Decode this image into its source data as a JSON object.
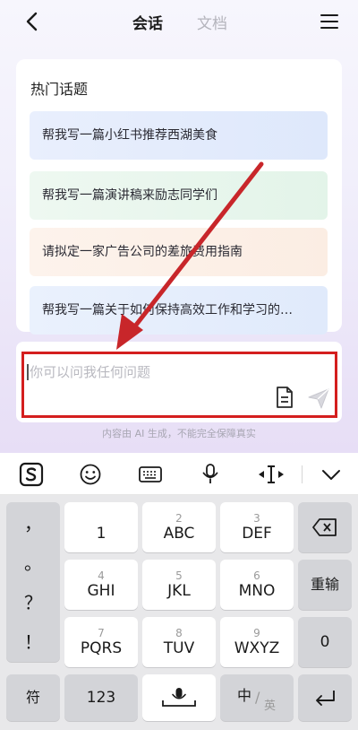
{
  "header": {
    "tabs": [
      {
        "label": "会话",
        "active": true
      },
      {
        "label": "文档",
        "active": false
      }
    ]
  },
  "hot_topics": {
    "title": "热门话题",
    "items": [
      "帮我写一篇小红书推荐西湖美食",
      "帮我写一篇演讲稿来励志同学们",
      "请拟定一家广告公司的差旅费用指南",
      "帮我写一篇关于如何保持高效工作和学习的…"
    ]
  },
  "composer": {
    "placeholder": "你可以问我任何问题",
    "disclaimer": "内容由 AI 生成，不能完全保障真实"
  },
  "keyboard": {
    "punctuation": [
      "，",
      "。",
      "？",
      "！"
    ],
    "keys": [
      {
        "num": "",
        "main": "1"
      },
      {
        "num": "2",
        "main": "ABC"
      },
      {
        "num": "3",
        "main": "DEF"
      },
      {
        "num": "4",
        "main": "GHI"
      },
      {
        "num": "5",
        "main": "JKL"
      },
      {
        "num": "6",
        "main": "MNO"
      },
      {
        "num": "7",
        "main": "PQRS"
      },
      {
        "num": "8",
        "main": "TUV"
      },
      {
        "num": "9",
        "main": "WXYZ"
      }
    ],
    "retype": "重输",
    "zero": "0",
    "symbols": "符",
    "numbers": "123",
    "lang_primary": "中",
    "lang_secondary": "英"
  },
  "colors": {
    "highlight": "#d41e1e",
    "arrow": "#c8262a",
    "accent_active_tab": "#1c1c1c",
    "inactive_tab": "#b4b4bc"
  },
  "icons": [
    "back-icon",
    "menu-icon",
    "document-icon",
    "send-icon",
    "sogou-logo-icon",
    "emoji-icon",
    "keyboard-icon",
    "microphone-icon",
    "cursor-move-icon",
    "chevron-down-icon",
    "backspace-icon",
    "enter-icon"
  ]
}
